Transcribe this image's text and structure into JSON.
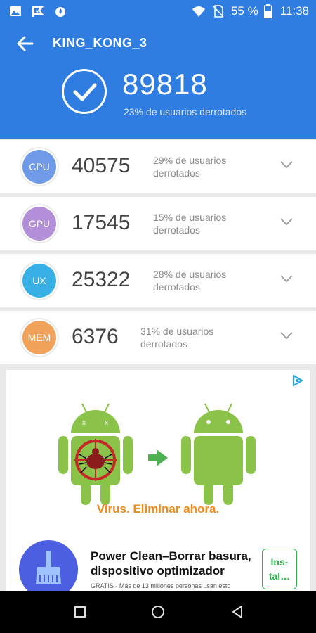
{
  "status_bar": {
    "battery": "55 %",
    "time": "11:38",
    "icons": [
      "image-icon",
      "check-flag-icon",
      "flame-icon",
      "wifi-icon",
      "no-sim-icon",
      "battery-icon"
    ]
  },
  "header": {
    "title": "KING_KONG_3",
    "score": "89818",
    "score_subtitle": "23% de usuarios derrotados"
  },
  "results": [
    {
      "badge": "CPU",
      "color": "#6f9ae8",
      "value": "40575",
      "desc": "29% de usuarios derrotados"
    },
    {
      "badge": "GPU",
      "color": "#b48fd9",
      "value": "17545",
      "desc": "15% de usuarios derrotados"
    },
    {
      "badge": "UX",
      "color": "#38b0e6",
      "value": "25322",
      "desc": "28% de usuarios derrotados"
    },
    {
      "badge": "MEM",
      "color": "#f0a25a",
      "value": "6376",
      "desc": "31% de usuarios derrotados"
    }
  ],
  "ad": {
    "tagline": "Virus. Eliminar ahora.",
    "title": "Power Clean–Borrar basura, dispositivo optimizador",
    "small_text": "GRATIS · Más de 13 millones personas usan esto",
    "install_label": "Ins-\ntal…",
    "colors": {
      "android_green": "#8bc34a",
      "arrow_green": "#4caf50",
      "virus_red": "#c62828",
      "tagline": "#f08a1c",
      "install": "#2bb04a"
    }
  },
  "colors": {
    "header": "#2f7de1",
    "background": "#e9e9e9"
  }
}
